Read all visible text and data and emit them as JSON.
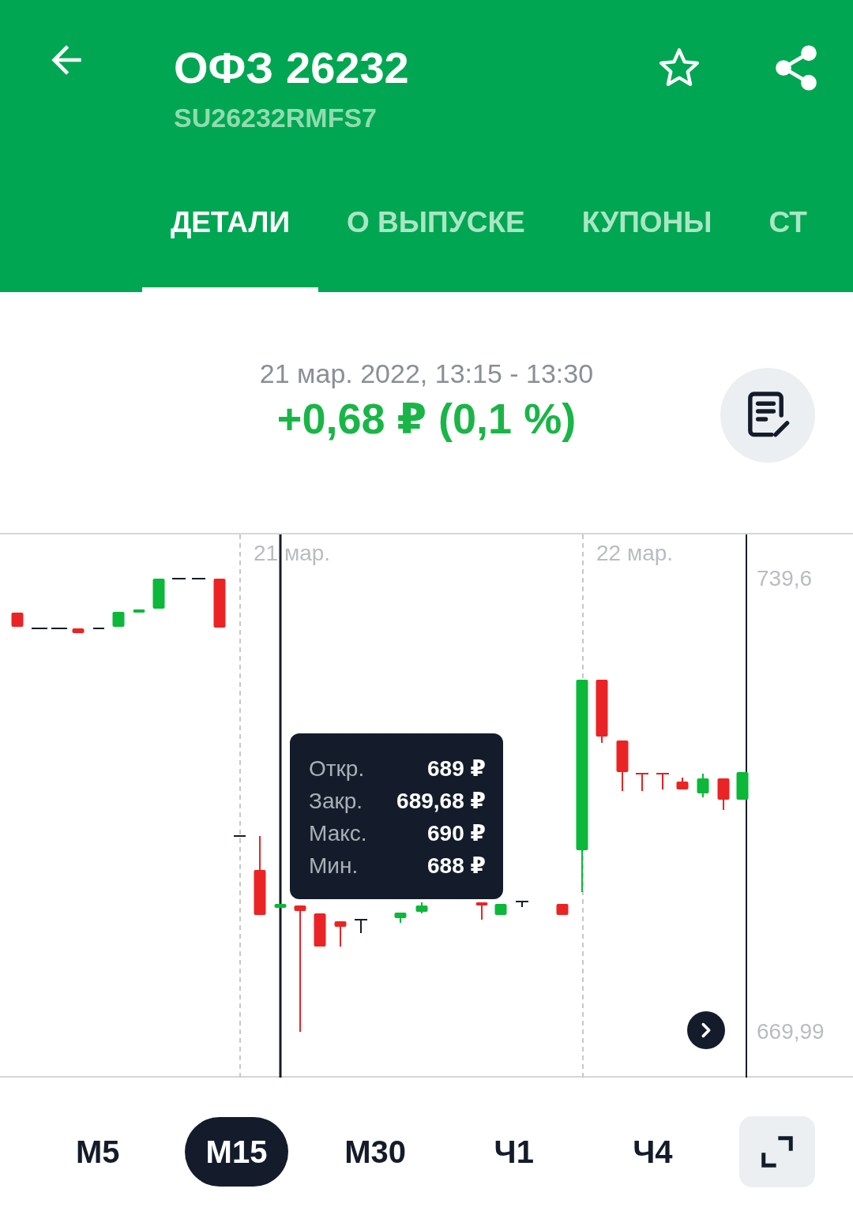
{
  "header": {
    "title": "ОФЗ 26232",
    "subtitle": "SU26232RMFS7"
  },
  "tabs": [
    {
      "label": "ДЕТАЛИ",
      "selected": true
    },
    {
      "label": "О ВЫПУСКЕ",
      "selected": false
    },
    {
      "label": "КУПОНЫ",
      "selected": false
    },
    {
      "label": "СТ",
      "selected": false
    }
  ],
  "summary": {
    "period": "21 мар. 2022, 13:15 - 13:30",
    "change": "+0,68 ₽ (0,1 %)"
  },
  "chart": {
    "date_labels": [
      "21 мар.",
      "22 мар."
    ],
    "price_labels": [
      "739,6",
      "669,99"
    ],
    "tooltip": [
      {
        "label": "Откр.",
        "value": "689 ₽"
      },
      {
        "label": "Закр.",
        "value": "689,68 ₽"
      },
      {
        "label": "Макс.",
        "value": "690 ₽"
      },
      {
        "label": "Мин.",
        "value": "688 ₽"
      }
    ]
  },
  "periods": [
    {
      "label": "М5",
      "selected": false
    },
    {
      "label": "М15",
      "selected": true
    },
    {
      "label": "М30",
      "selected": false
    },
    {
      "label": "Ч1",
      "selected": false
    },
    {
      "label": "Ч4",
      "selected": false
    }
  ]
}
